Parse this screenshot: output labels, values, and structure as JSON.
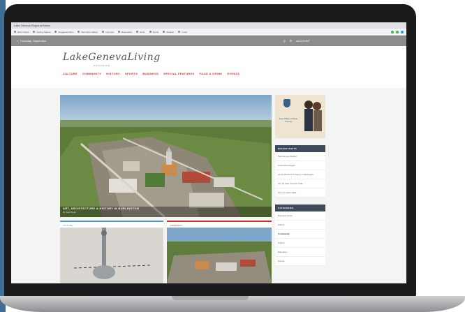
{
  "browser": {
    "tab_title": "Lake Geneva Regional News",
    "bookmarks": [
      "Most Visited",
      "Getting Started",
      "Suggested Sites",
      "Web Slice Gallery",
      "Imported",
      "Bookmarks",
      "News",
      "Sports",
      "Weather",
      "Local"
    ],
    "extension_colors": [
      "#4caf50",
      "#4caf50",
      "#2196f3"
    ]
  },
  "topbar": {
    "date": "Thursday, September",
    "tools": [
      "Q",
      "☰",
      "ACCOUNT"
    ]
  },
  "header": {
    "logo_text": "LakeGenevaLiving",
    "logo_sub": "MAGAZINE",
    "nav": [
      "CULTURE",
      "COMMUNITY",
      "HISTORY",
      "SPORTS",
      "BUSINESS",
      "SPECIAL FEATURES",
      "FOOD & DRINK",
      "EVENTS"
    ]
  },
  "hero": {
    "caption": "ART, ARCHITECTURE & HISTORY IN BURLINGTON",
    "caption_sub": "By Staff Writer"
  },
  "cards": [
    {
      "label": "CULTURE"
    },
    {
      "label": "COMMUNITY"
    }
  ],
  "sidebar": {
    "ad_text": "Four Pillars of Wine Country",
    "recent_title": "RECENT POSTS",
    "recent": [
      "Fall Farmers Market",
      "Around the Region",
      "Art Architecture & History in Burlington",
      "Top 10 Lake Geneva Trails",
      "Summer Wine Walk"
    ],
    "categories_title": "CATEGORIES",
    "categories": [
      "Business News",
      "History",
      "Community",
      "Culture",
      "Education",
      "Events"
    ],
    "selected_category": 2
  }
}
